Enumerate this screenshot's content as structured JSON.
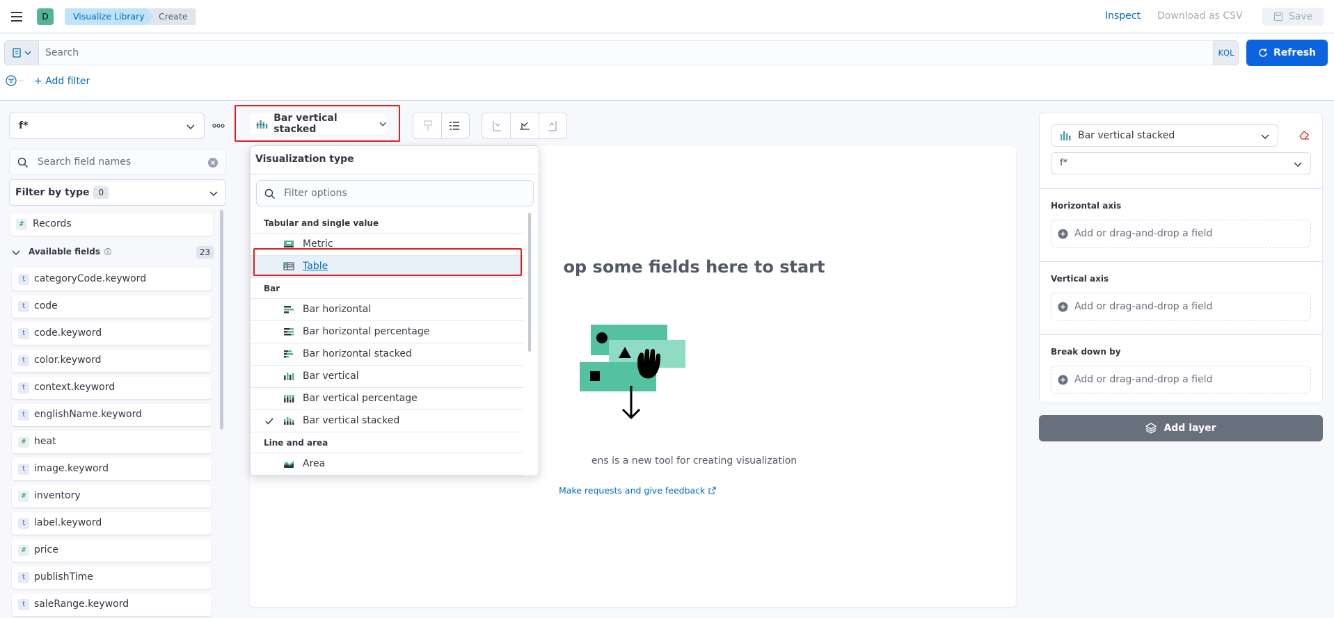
{
  "header": {
    "avatar_letter": "D",
    "breadcrumbs": [
      "Visualize Library",
      "Create"
    ],
    "inspect": "Inspect",
    "download_csv": "Download as CSV",
    "save": "Save"
  },
  "query": {
    "search_placeholder": "Search",
    "language": "KQL",
    "refresh": "Refresh",
    "add_filter": "+ Add filter"
  },
  "sidebar": {
    "index_pattern": "f*",
    "search_placeholder": "Search field names",
    "filter_by_type": "Filter by type",
    "filter_count": "0",
    "records_label": "Records",
    "available_fields_label": "Available fields",
    "available_fields_count": "23",
    "fields": [
      {
        "name": "categoryCode.keyword",
        "type": "t"
      },
      {
        "name": "code",
        "type": "t"
      },
      {
        "name": "code.keyword",
        "type": "t"
      },
      {
        "name": "color.keyword",
        "type": "t"
      },
      {
        "name": "context.keyword",
        "type": "t"
      },
      {
        "name": "englishName.keyword",
        "type": "t"
      },
      {
        "name": "heat",
        "type": "#"
      },
      {
        "name": "image.keyword",
        "type": "t"
      },
      {
        "name": "inventory",
        "type": "#"
      },
      {
        "name": "label.keyword",
        "type": "t"
      },
      {
        "name": "price",
        "type": "#"
      },
      {
        "name": "publishTime",
        "type": "t"
      },
      {
        "name": "saleRange.keyword",
        "type": "t"
      }
    ]
  },
  "toolbar": {
    "chart_type": "Bar vertical stacked"
  },
  "workspace": {
    "empty_title": "op some fields here to start",
    "lens_description": "ens is a new tool for creating visualization",
    "feedback_link": "Make requests and give feedback"
  },
  "dropdown": {
    "title": "Visualization type",
    "filter_placeholder": "Filter options",
    "groups": [
      {
        "label": "Tabular and single value",
        "options": [
          "Metric",
          "Table"
        ]
      },
      {
        "label": "Bar",
        "options": [
          "Bar horizontal",
          "Bar horizontal percentage",
          "Bar horizontal stacked",
          "Bar vertical",
          "Bar vertical percentage",
          "Bar vertical stacked"
        ]
      },
      {
        "label": "Line and area",
        "options": [
          "Area"
        ]
      }
    ],
    "highlighted_option": "Table",
    "checked_option": "Bar vertical stacked"
  },
  "config": {
    "layer_chart_type": "Bar vertical stacked",
    "layer_index": "f*",
    "horizontal_axis": "Horizontal axis",
    "vertical_axis": "Vertical axis",
    "break_down_by": "Break down by",
    "drop_placeholder": "Add or drag-and-drop a field",
    "add_layer": "Add layer"
  },
  "colors": {
    "primary": "#0b64dd",
    "link": "#006bb8",
    "highlight_border": "#e0201f",
    "accent_teal": "#54b399"
  }
}
